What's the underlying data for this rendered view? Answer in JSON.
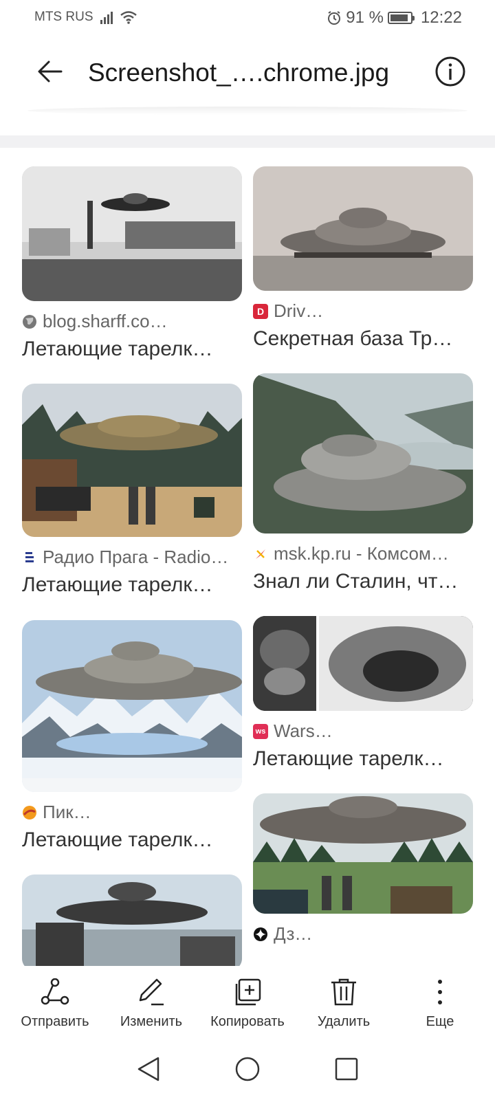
{
  "status_bar": {
    "carrier": "MTS RUS",
    "battery": "91 %",
    "time": "12:22",
    "icons": [
      "signal-icon",
      "wifi-icon",
      "alarm-icon",
      "battery-icon"
    ]
  },
  "header": {
    "title": "Screenshot_….chrome.jpg",
    "back_icon": "back-arrow-icon",
    "info_icon": "info-icon"
  },
  "results": [
    {
      "source": "blog.sharff.co…",
      "caption": "Летающие тарелк…",
      "source_icon": "globe-icon",
      "source_color": "#6b6b6b"
    },
    {
      "source": "Driv…",
      "caption": "Секретная база Тр…",
      "source_icon": "drive2-logo-icon",
      "source_color": "#d9263a"
    },
    {
      "source": "Радио Прага - Radio…",
      "caption": "Летающие тарелк…",
      "source_icon": "radio-praha-icon",
      "source_color": "#2a3c8f"
    },
    {
      "source": "msk.kp.ru - Комсом…",
      "caption": "Знал ли Сталин, чт…",
      "source_icon": "kp-logo-icon",
      "source_color": "#e43c2f"
    },
    {
      "source": "Wars…",
      "caption": "Летающие тарелк…",
      "source_icon": "wars-logo-icon",
      "source_color": "#e02f56"
    },
    {
      "source": "Пик…",
      "caption": "Летающие тарелк…",
      "source_icon": "pikabu-logo-icon",
      "source_color": "#f39a1d"
    },
    {
      "source": "Дз…",
      "caption": "",
      "source_icon": "dzen-logo-icon",
      "source_color": "#111111"
    },
    {
      "source": "",
      "caption": "",
      "source_icon": "",
      "source_color": ""
    }
  ],
  "toolbar": {
    "send": "Отправить",
    "edit": "Изменить",
    "copy": "Копировать",
    "delete": "Удалить",
    "more": "Еще"
  },
  "nav": [
    "back-nav-icon",
    "home-nav-icon",
    "recents-nav-icon"
  ]
}
